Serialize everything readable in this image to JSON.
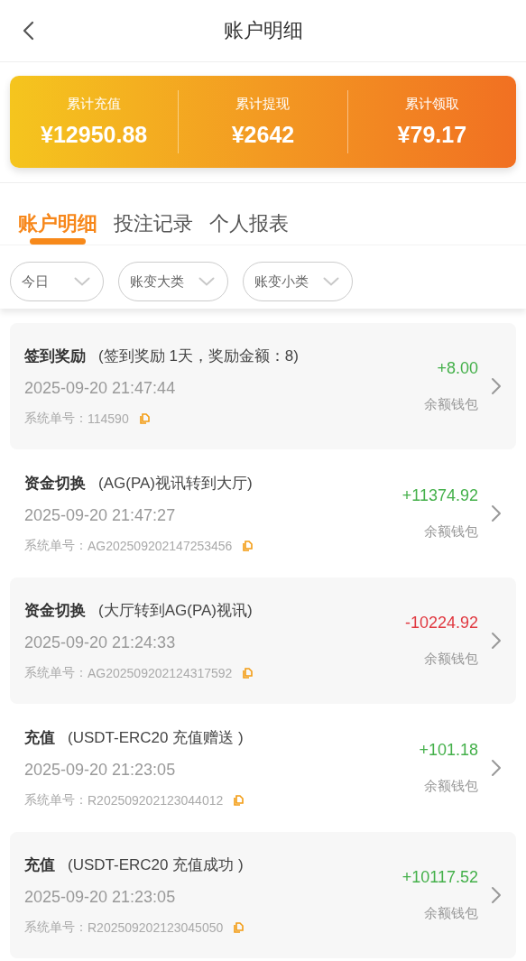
{
  "header": {
    "title": "账户明细"
  },
  "summary": [
    {
      "label": "累计充值",
      "value": "¥12950.88"
    },
    {
      "label": "累计提现",
      "value": "¥2642"
    },
    {
      "label": "累计领取",
      "value": "¥79.17"
    }
  ],
  "tabs": [
    {
      "label": "账户明细",
      "selected": true
    },
    {
      "label": "投注记录",
      "selected": false
    },
    {
      "label": "个人报表",
      "selected": false
    }
  ],
  "filters": [
    {
      "label": "今日"
    },
    {
      "label": "账变大类"
    },
    {
      "label": "账变小类"
    }
  ],
  "records": [
    {
      "type": "签到奖励",
      "detail": "(签到奖励 1天，奖励金额：8)",
      "time": "2025-09-20 21:47:44",
      "order_label": "系统单号：",
      "order_no": "114590",
      "amount": "+8.00",
      "kind": "credit",
      "wallet": "余额钱包"
    },
    {
      "type": "资金切换",
      "detail": "(AG(PA)视讯转到大厅)",
      "time": "2025-09-20 21:47:27",
      "order_label": "系统单号：",
      "order_no": "AG202509202147253456",
      "amount": "+11374.92",
      "kind": "credit",
      "wallet": "余额钱包"
    },
    {
      "type": "资金切换",
      "detail": "(大厅转到AG(PA)视讯)",
      "time": "2025-09-20 21:24:33",
      "order_label": "系统单号：",
      "order_no": "AG202509202124317592",
      "amount": "-10224.92",
      "kind": "debit",
      "wallet": "余额钱包"
    },
    {
      "type": "充值",
      "detail": "(USDT-ERC20 充值赠送 )",
      "time": "2025-09-20 21:23:05",
      "order_label": "系统单号：",
      "order_no": "R202509202123044012",
      "amount": "+101.18",
      "kind": "credit",
      "wallet": "余额钱包"
    },
    {
      "type": "充值",
      "detail": "(USDT-ERC20 充值成功 )",
      "time": "2025-09-20 21:23:05",
      "order_label": "系统单号：",
      "order_no": "R202509202123045050",
      "amount": "+10117.52",
      "kind": "credit",
      "wallet": "余额钱包"
    }
  ]
}
